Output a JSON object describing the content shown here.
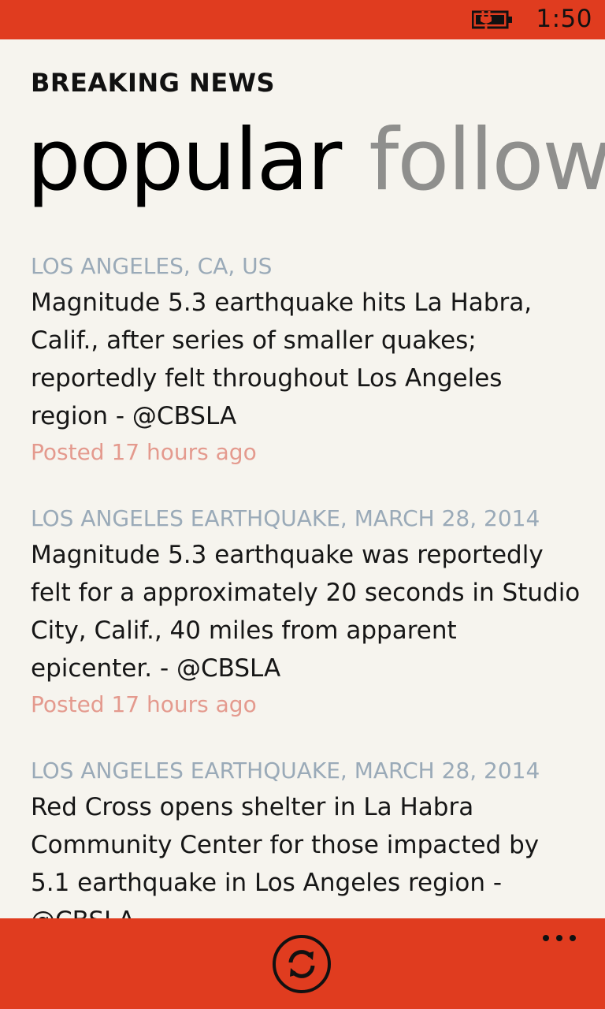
{
  "status_bar": {
    "time": "1:50",
    "battery_icon": "battery-charging-icon",
    "background": "#e03c1f"
  },
  "header": {
    "app_title": "BREAKING NEWS",
    "pivots": [
      {
        "label": "popular",
        "active": true
      },
      {
        "label": "followi",
        "active": false
      }
    ]
  },
  "feed": {
    "items": [
      {
        "topic": "LOS ANGELES, CA, US",
        "text": "Magnitude 5.3 earthquake hits La Habra, Calif., after series of smaller quakes; reportedly felt throughout Los Angeles region - @CBSLA",
        "posted": "Posted 17 hours ago"
      },
      {
        "topic": "LOS ANGELES EARTHQUAKE, MARCH 28, 2014",
        "text": "Magnitude 5.3 earthquake was reportedly felt for a approximately 20 seconds in Studio City, Calif., 40 miles from apparent epicenter. - @CBSLA",
        "posted": "Posted 17 hours ago"
      },
      {
        "topic": "LOS ANGELES EARTHQUAKE, MARCH 28, 2014",
        "text": "Red Cross opens shelter in La Habra Community Center for those impacted by 5.1 earthquake in Los Angeles region - @CBSLA",
        "posted": ""
      }
    ]
  },
  "app_bar": {
    "refresh_icon": "refresh-icon",
    "more_icon": "more-icon",
    "background": "#e03c1f"
  },
  "colors": {
    "accent": "#e03c1f",
    "topic": "#9aaab8",
    "timestamp": "#e49a8e",
    "background": "#f6f4ee"
  }
}
